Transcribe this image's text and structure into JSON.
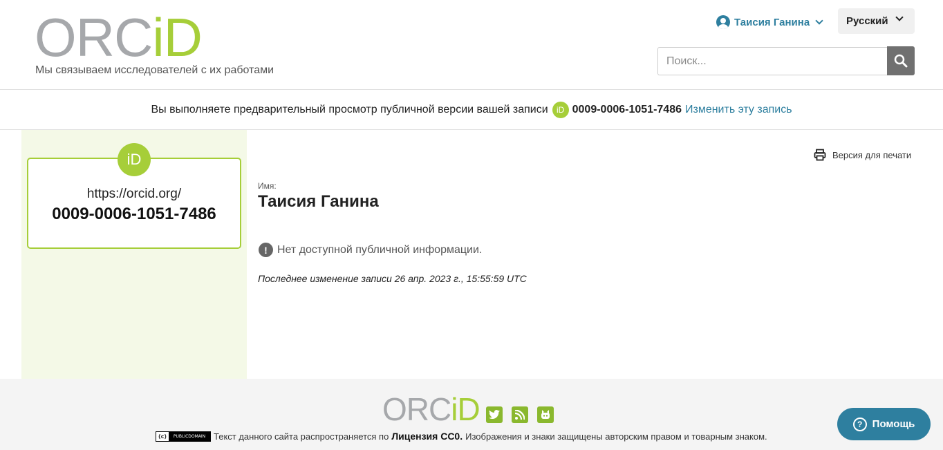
{
  "header": {
    "logo_text_orc": "ORC",
    "logo_text_id": "iD",
    "tagline": "Мы связываем исследователей с их работами",
    "user_name": "Таисия Ганина",
    "language": "Русский",
    "search_placeholder": "Поиск..."
  },
  "banner": {
    "text": "Вы выполняете предварительный просмотр публичной версии вашей записи",
    "orcid_id": "0009-0006-1051-7486",
    "edit_link": "Изменить эту запись",
    "id_badge": "iD"
  },
  "sidebar": {
    "badge": "iD",
    "orcid_url": "https://orcid.org/",
    "orcid_id": "0009-0006-1051-7486"
  },
  "main": {
    "print_label": "Версия для печати",
    "name_label": "Имя:",
    "name_value": "Таисия Ганина",
    "warn_glyph": "!",
    "no_info": "Нет доступной публичной информации.",
    "last_modified": "Последнее изменение записи 26 апр. 2023 г., 15:55:59 UTC"
  },
  "footer": {
    "logo_orc": "ORC",
    "logo_id": "iD",
    "cc_glyph": "(c)",
    "cc_badge": "PUBLICDOMAIN",
    "license_prefix": "Текст данного сайта распространяется по",
    "license_name": "Лицензия CC0.",
    "license_suffix": "Изображения и знаки защищены авторским правом и товарным знаком.",
    "social_icons": [
      "twitter-icon",
      "rss-icon",
      "github-icon"
    ]
  },
  "help": {
    "glyph": "?",
    "label": "Помощь"
  },
  "colors": {
    "accent_green": "#a6ce39",
    "link_blue": "#2e7f9f",
    "logo_gray": "#a6a8ab"
  }
}
